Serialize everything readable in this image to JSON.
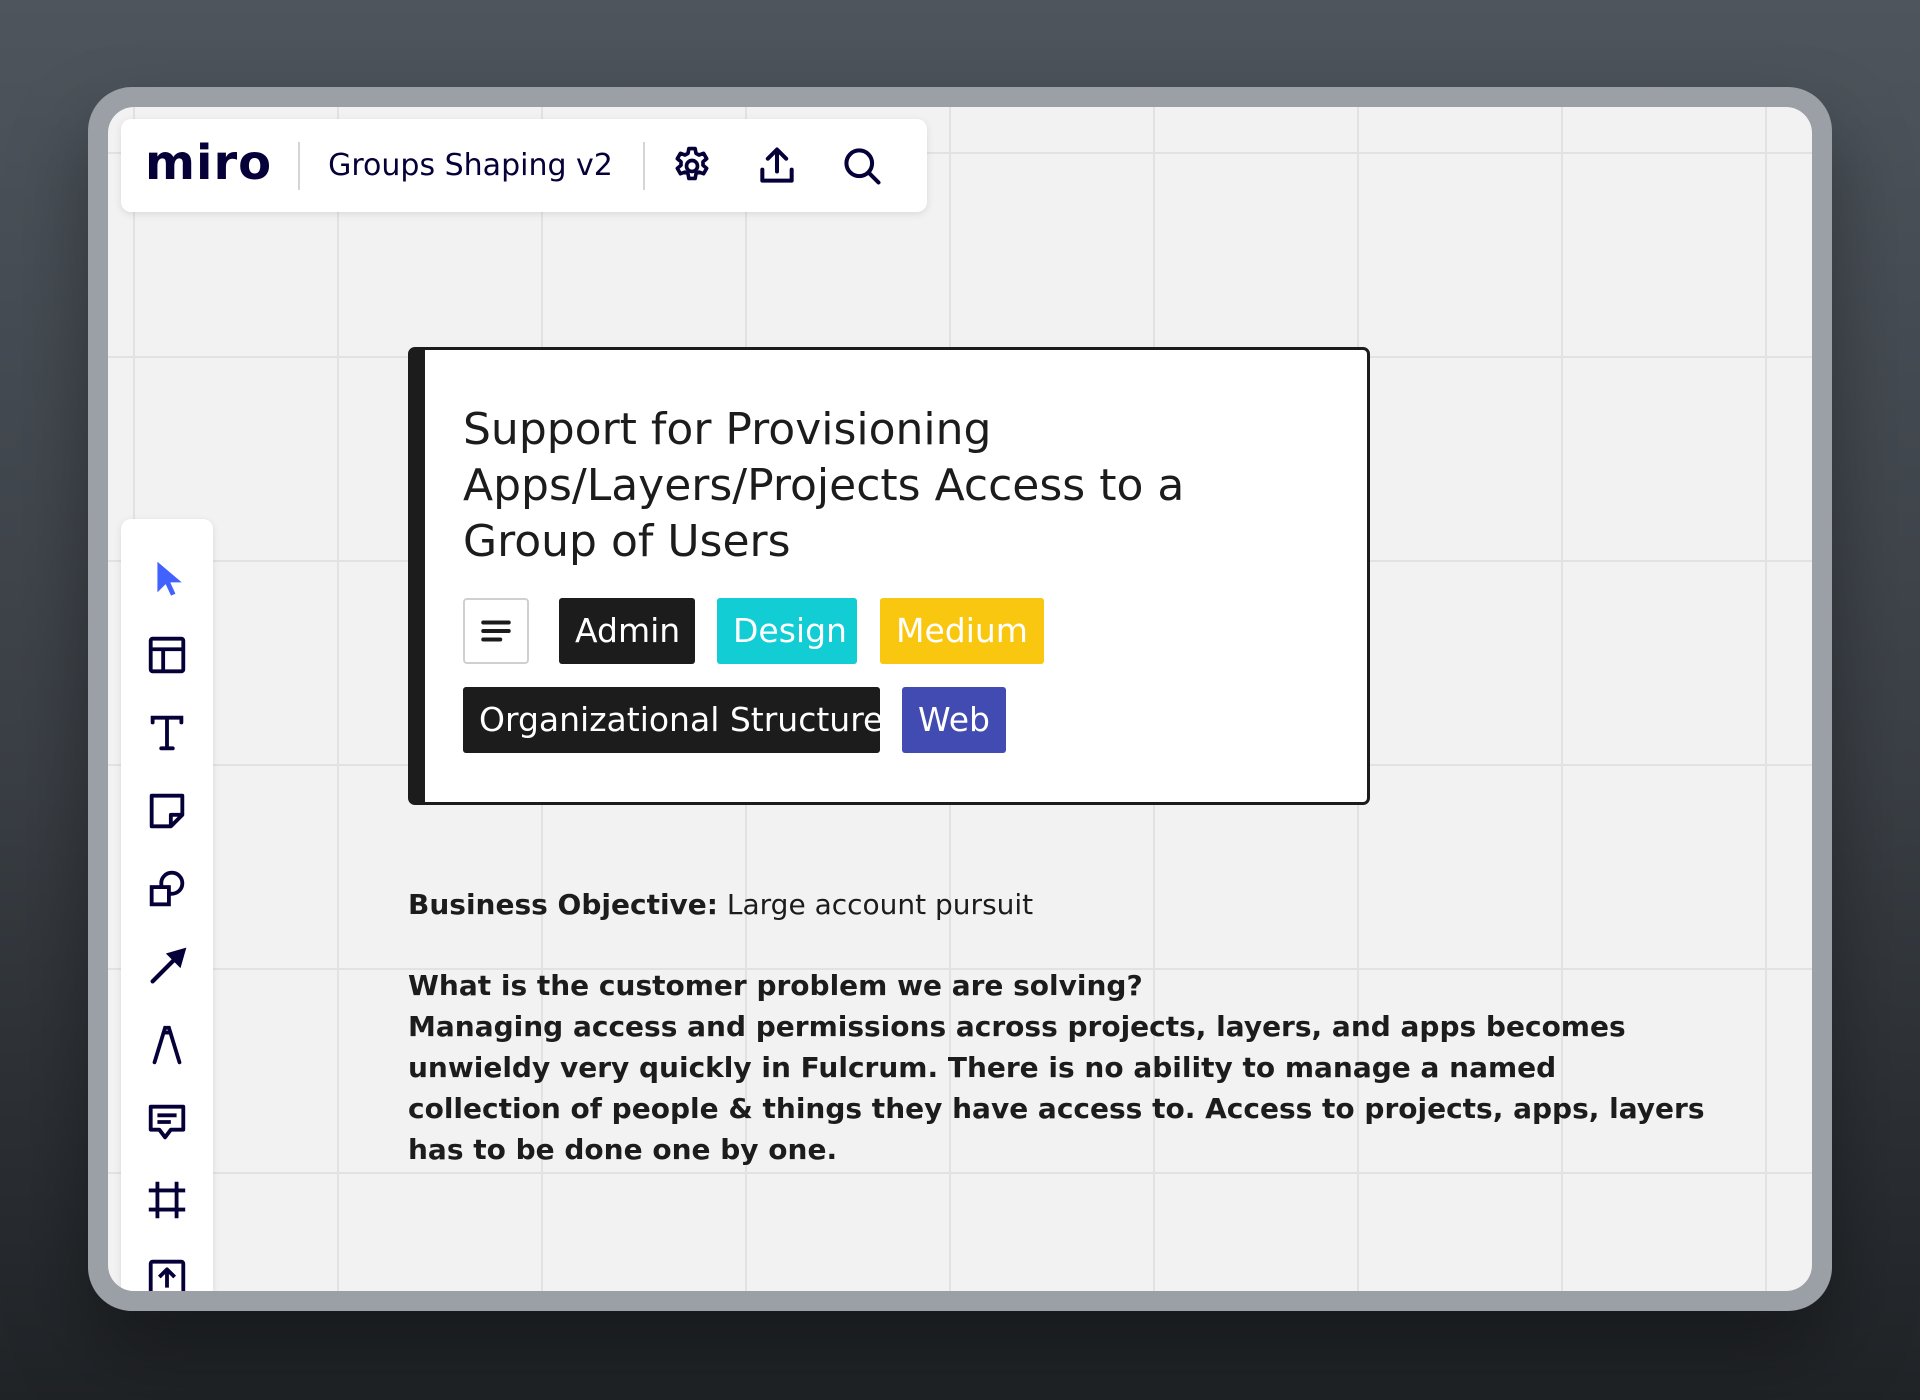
{
  "topbar": {
    "logo": "miro",
    "board_title": "Groups Shaping v2",
    "icons": [
      "gear-icon",
      "upload-icon",
      "search-icon"
    ]
  },
  "toolbar": {
    "tools": [
      "select-cursor-icon",
      "templates-icon",
      "text-icon",
      "sticky-note-icon",
      "shapes-icon",
      "arrow-icon",
      "pen-icon",
      "comment-icon",
      "frame-icon",
      "upload-icon"
    ],
    "active_color": "#4262ff"
  },
  "card": {
    "title": "Support for Provisioning Apps/Layers/Projects Access to a Group of Users",
    "description_icon": "lines-icon",
    "tags": [
      {
        "label": "Admin",
        "color": "#1c1c1c"
      },
      {
        "label": "Design",
        "color": "#12cdd4"
      },
      {
        "label": "Medium",
        "color": "#fac710"
      },
      {
        "label": "Organizational Structure",
        "color": "#1c1c1c"
      },
      {
        "label": "Web",
        "color": "#414bb2"
      }
    ]
  },
  "content": {
    "objective_label": "Business Objective:",
    "objective_value": "Large account pursuit",
    "problem_question": "What is the customer problem we are solving?",
    "problem_answer": "Managing access and permissions across projects, layers, and apps becomes unwieldy very quickly in Fulcrum. There is no ability to manage a named collection of people & things they have access to. Access to projects, apps, layers has to be done one by one."
  }
}
